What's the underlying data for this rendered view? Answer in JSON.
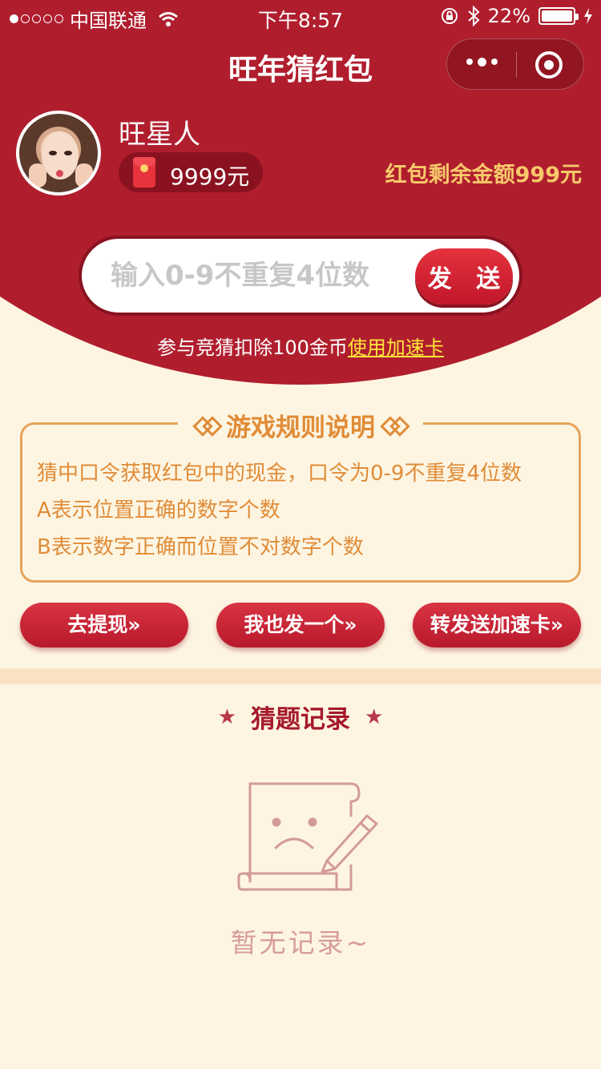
{
  "status_bar": {
    "carrier": "中国联通",
    "time": "下午8:57",
    "battery": "22%",
    "signal_bars_filled": 1,
    "signal_bars_total": 5
  },
  "nav": {
    "title": "旺年猜红包"
  },
  "user": {
    "name": "旺星人",
    "balance": "9999元",
    "remaining_label": "红包剩余金额999元"
  },
  "guess": {
    "placeholder": "输入0-9不重复4位数",
    "send_label": "发 送",
    "hint_prefix": "参与竞猜扣除100金币",
    "hint_link": "使用加速卡"
  },
  "rules": {
    "title": "游戏规则说明",
    "lines": [
      "猜中口令获取红包中的现金，口令为0-9不重复4位数",
      "A表示位置正确的数字个数",
      "B表示数字正确而位置不对数字个数"
    ]
  },
  "actions": [
    {
      "label": "去提现»"
    },
    {
      "label": "我也发一个»"
    },
    {
      "label": "转发送加速卡»"
    }
  ],
  "records": {
    "title": "猜题记录",
    "empty_text": "暂无记录~"
  },
  "colors": {
    "primary_red": "#b01e2e",
    "accent_orange": "#e08c38",
    "background_cream": "#fdf5e2",
    "gold": "#f7c86a"
  }
}
